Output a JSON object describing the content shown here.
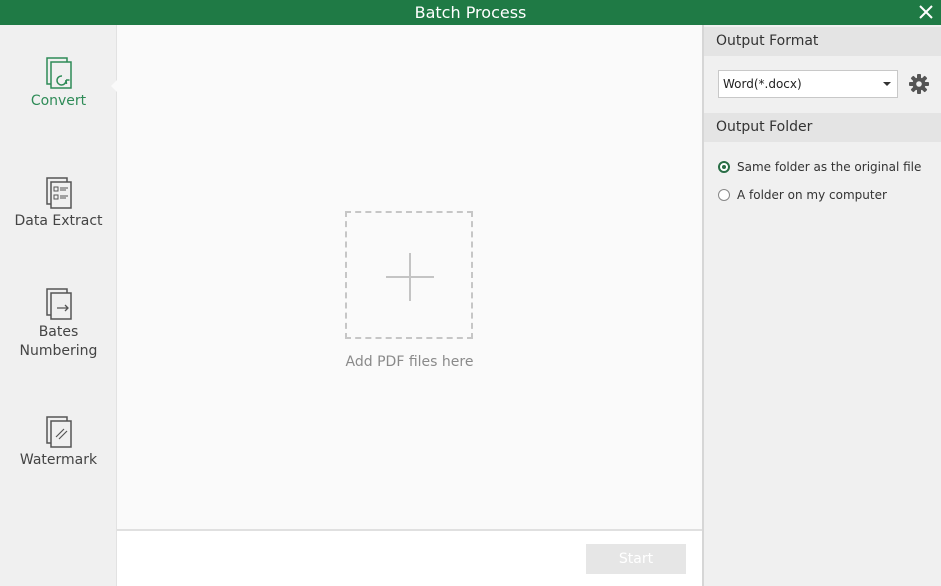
{
  "window": {
    "title": "Batch Process"
  },
  "sidebar": {
    "items": [
      {
        "label": "Convert",
        "icon": "convert-icon",
        "active": true
      },
      {
        "label": "Data Extract",
        "icon": "data-extract-icon",
        "active": false
      },
      {
        "label": "Bates\nNumbering",
        "icon": "bates-numbering-icon",
        "active": false
      },
      {
        "label": "Watermark",
        "icon": "watermark-icon",
        "active": false
      }
    ]
  },
  "main": {
    "drop_label": "Add PDF files here",
    "start_label": "Start"
  },
  "panel": {
    "output_format": {
      "heading": "Output Format",
      "selected": "Word(*.docx)"
    },
    "output_folder": {
      "heading": "Output Folder",
      "options": [
        {
          "label": "Same folder as the original file",
          "checked": true
        },
        {
          "label": "A folder on my computer",
          "checked": false
        }
      ]
    }
  },
  "colors": {
    "titlebar": "#1f7a45",
    "accent": "#2e8b57",
    "radio_checked": "#2a6e46"
  }
}
